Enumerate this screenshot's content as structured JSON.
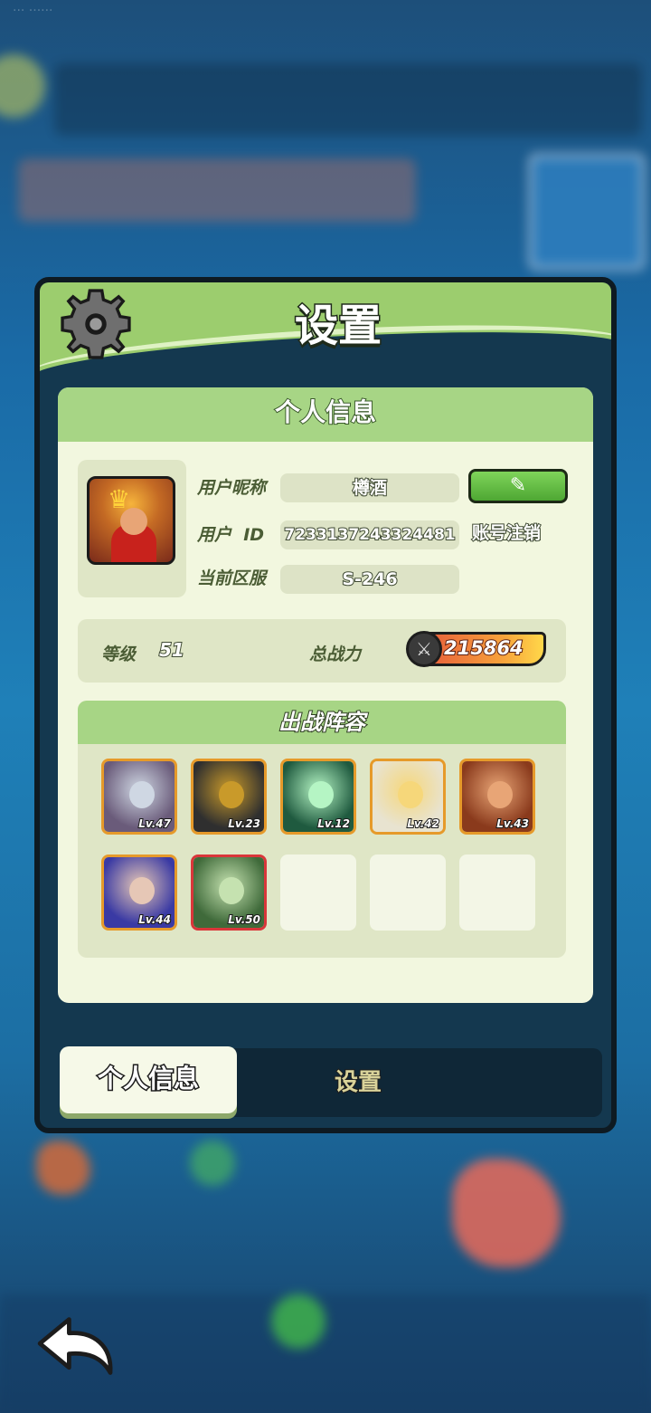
{
  "status_bar": {
    "time": "··· ······"
  },
  "dialog": {
    "title": "设置",
    "info_section": {
      "header": "个人信息",
      "nickname_label": "用户昵称",
      "nickname_value": "樽酒",
      "user_id_label": "用户  ID",
      "user_id_value": "7233137243324481",
      "server_label": "当前区服",
      "server_value": "S-246",
      "edit_icon": "pencil-icon",
      "logout_label": "账号注销"
    },
    "stats": {
      "level_label": "等级",
      "level_value": "51",
      "power_label": "总战力",
      "power_value": "215864",
      "power_icon": "crossed-swords-icon"
    },
    "lineup": {
      "header": "出战阵容",
      "heroes": [
        {
          "level": "Lv.47",
          "color": "#6a5b7a",
          "face": "#cfd7e3"
        },
        {
          "level": "Lv.23",
          "color": "#2f2f2f",
          "face": "#c99a2a"
        },
        {
          "level": "Lv.12",
          "color": "#1f5a3f",
          "face": "#b5f5c4"
        },
        {
          "level": "Lv.42",
          "color": "#e8e3d0",
          "face": "#f6d77a"
        },
        {
          "level": "Lv.43",
          "color": "#8a3a1c",
          "face": "#e8a576"
        },
        {
          "level": "Lv.44",
          "color": "#3a3aa4",
          "face": "#e6c7b6"
        },
        {
          "level": "Lv.50",
          "color": "#3f6a3a",
          "face": "#c5e2b0"
        }
      ],
      "empty_slots": 3
    },
    "tabs": [
      {
        "label": "个人信息",
        "active": true
      },
      {
        "label": "设置",
        "active": false
      }
    ]
  },
  "back_button": {
    "icon": "back-arrow-icon"
  },
  "colors": {
    "panel_green": "#9ccd6e",
    "card_bg": "#f2f7df",
    "edit_green": "#5cbf3d",
    "power_orange": "#f7a33b"
  }
}
